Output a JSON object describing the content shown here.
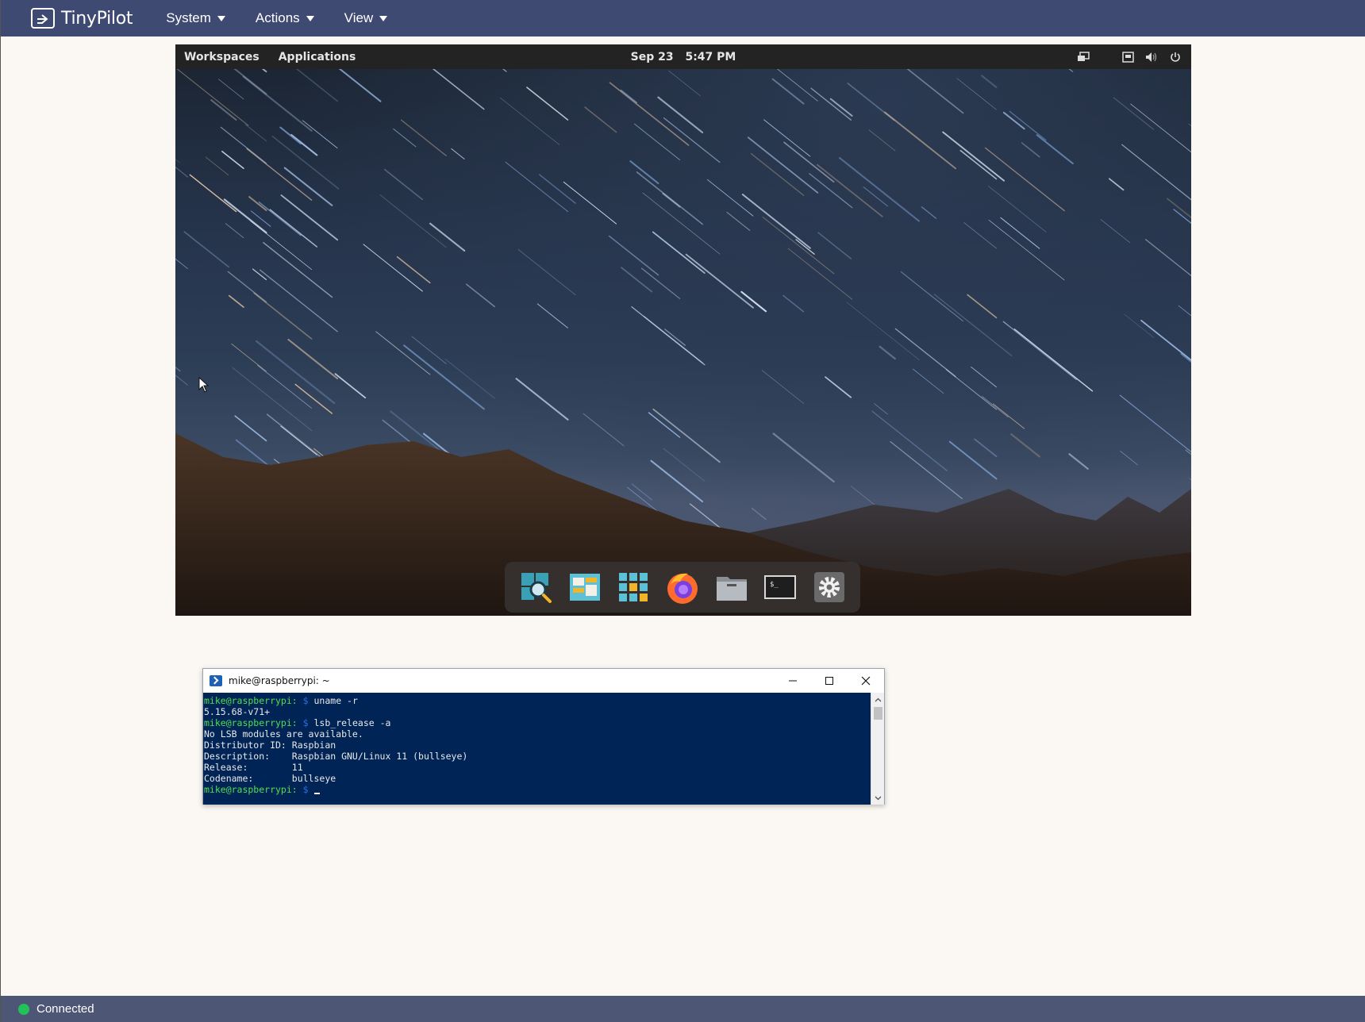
{
  "app": {
    "brand": "TinyPilot",
    "menu": [
      {
        "label": "System"
      },
      {
        "label": "Actions"
      },
      {
        "label": "View"
      }
    ]
  },
  "remote": {
    "topbar": {
      "workspaces": "Workspaces",
      "applications": "Applications",
      "date": "Sep 23",
      "time": "5:47 PM"
    },
    "tray_icons": [
      "screen-icon",
      "network-icon",
      "volume-icon",
      "power-icon"
    ],
    "dock_apps": [
      "search-app-icon",
      "window-switcher-icon",
      "app-grid-icon",
      "firefox-icon",
      "files-icon",
      "terminal-icon",
      "settings-icon"
    ]
  },
  "terminal": {
    "title": "mike@raspberrypi: ~",
    "lines": [
      {
        "type": "prompt",
        "user": "mike@raspberrypi",
        "sep": ":",
        "dollar": " $",
        "cmd": " uname -r"
      },
      {
        "type": "out",
        "text": "5.15.68-v71+"
      },
      {
        "type": "prompt",
        "user": "mike@raspberrypi",
        "sep": ":",
        "dollar": " $",
        "cmd": " lsb_release -a"
      },
      {
        "type": "out",
        "text": "No LSB modules are available."
      },
      {
        "type": "out",
        "text": "Distributor ID: Raspbian"
      },
      {
        "type": "out",
        "text": "Description:    Raspbian GNU/Linux 11 (bullseye)"
      },
      {
        "type": "out",
        "text": "Release:        11"
      },
      {
        "type": "out",
        "text": "Codename:       bullseye"
      },
      {
        "type": "prompt",
        "user": "mike@raspberrypi",
        "sep": ":",
        "dollar": " $",
        "cmd": " "
      }
    ]
  },
  "status": {
    "label": "Connected",
    "color": "#22c25a"
  }
}
